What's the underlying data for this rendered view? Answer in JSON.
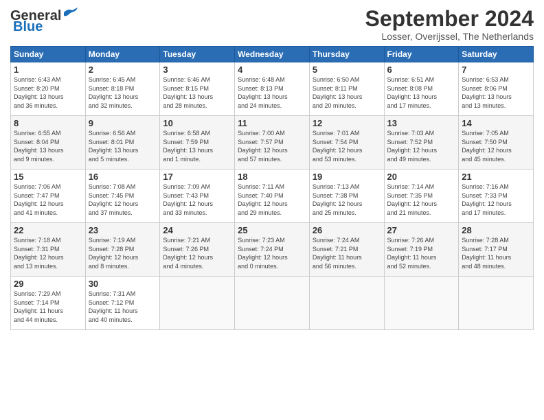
{
  "header": {
    "logo_line1": "General",
    "logo_line2": "Blue",
    "month_title": "September 2024",
    "location": "Losser, Overijssel, The Netherlands"
  },
  "days_of_week": [
    "Sunday",
    "Monday",
    "Tuesday",
    "Wednesday",
    "Thursday",
    "Friday",
    "Saturday"
  ],
  "weeks": [
    [
      {
        "day": "1",
        "info": "Sunrise: 6:43 AM\nSunset: 8:20 PM\nDaylight: 13 hours\nand 36 minutes."
      },
      {
        "day": "2",
        "info": "Sunrise: 6:45 AM\nSunset: 8:18 PM\nDaylight: 13 hours\nand 32 minutes."
      },
      {
        "day": "3",
        "info": "Sunrise: 6:46 AM\nSunset: 8:15 PM\nDaylight: 13 hours\nand 28 minutes."
      },
      {
        "day": "4",
        "info": "Sunrise: 6:48 AM\nSunset: 8:13 PM\nDaylight: 13 hours\nand 24 minutes."
      },
      {
        "day": "5",
        "info": "Sunrise: 6:50 AM\nSunset: 8:11 PM\nDaylight: 13 hours\nand 20 minutes."
      },
      {
        "day": "6",
        "info": "Sunrise: 6:51 AM\nSunset: 8:08 PM\nDaylight: 13 hours\nand 17 minutes."
      },
      {
        "day": "7",
        "info": "Sunrise: 6:53 AM\nSunset: 8:06 PM\nDaylight: 13 hours\nand 13 minutes."
      }
    ],
    [
      {
        "day": "8",
        "info": "Sunrise: 6:55 AM\nSunset: 8:04 PM\nDaylight: 13 hours\nand 9 minutes."
      },
      {
        "day": "9",
        "info": "Sunrise: 6:56 AM\nSunset: 8:01 PM\nDaylight: 13 hours\nand 5 minutes."
      },
      {
        "day": "10",
        "info": "Sunrise: 6:58 AM\nSunset: 7:59 PM\nDaylight: 13 hours\nand 1 minute."
      },
      {
        "day": "11",
        "info": "Sunrise: 7:00 AM\nSunset: 7:57 PM\nDaylight: 12 hours\nand 57 minutes."
      },
      {
        "day": "12",
        "info": "Sunrise: 7:01 AM\nSunset: 7:54 PM\nDaylight: 12 hours\nand 53 minutes."
      },
      {
        "day": "13",
        "info": "Sunrise: 7:03 AM\nSunset: 7:52 PM\nDaylight: 12 hours\nand 49 minutes."
      },
      {
        "day": "14",
        "info": "Sunrise: 7:05 AM\nSunset: 7:50 PM\nDaylight: 12 hours\nand 45 minutes."
      }
    ],
    [
      {
        "day": "15",
        "info": "Sunrise: 7:06 AM\nSunset: 7:47 PM\nDaylight: 12 hours\nand 41 minutes."
      },
      {
        "day": "16",
        "info": "Sunrise: 7:08 AM\nSunset: 7:45 PM\nDaylight: 12 hours\nand 37 minutes."
      },
      {
        "day": "17",
        "info": "Sunrise: 7:09 AM\nSunset: 7:43 PM\nDaylight: 12 hours\nand 33 minutes."
      },
      {
        "day": "18",
        "info": "Sunrise: 7:11 AM\nSunset: 7:40 PM\nDaylight: 12 hours\nand 29 minutes."
      },
      {
        "day": "19",
        "info": "Sunrise: 7:13 AM\nSunset: 7:38 PM\nDaylight: 12 hours\nand 25 minutes."
      },
      {
        "day": "20",
        "info": "Sunrise: 7:14 AM\nSunset: 7:35 PM\nDaylight: 12 hours\nand 21 minutes."
      },
      {
        "day": "21",
        "info": "Sunrise: 7:16 AM\nSunset: 7:33 PM\nDaylight: 12 hours\nand 17 minutes."
      }
    ],
    [
      {
        "day": "22",
        "info": "Sunrise: 7:18 AM\nSunset: 7:31 PM\nDaylight: 12 hours\nand 13 minutes."
      },
      {
        "day": "23",
        "info": "Sunrise: 7:19 AM\nSunset: 7:28 PM\nDaylight: 12 hours\nand 8 minutes."
      },
      {
        "day": "24",
        "info": "Sunrise: 7:21 AM\nSunset: 7:26 PM\nDaylight: 12 hours\nand 4 minutes."
      },
      {
        "day": "25",
        "info": "Sunrise: 7:23 AM\nSunset: 7:24 PM\nDaylight: 12 hours\nand 0 minutes."
      },
      {
        "day": "26",
        "info": "Sunrise: 7:24 AM\nSunset: 7:21 PM\nDaylight: 11 hours\nand 56 minutes."
      },
      {
        "day": "27",
        "info": "Sunrise: 7:26 AM\nSunset: 7:19 PM\nDaylight: 11 hours\nand 52 minutes."
      },
      {
        "day": "28",
        "info": "Sunrise: 7:28 AM\nSunset: 7:17 PM\nDaylight: 11 hours\nand 48 minutes."
      }
    ],
    [
      {
        "day": "29",
        "info": "Sunrise: 7:29 AM\nSunset: 7:14 PM\nDaylight: 11 hours\nand 44 minutes."
      },
      {
        "day": "30",
        "info": "Sunrise: 7:31 AM\nSunset: 7:12 PM\nDaylight: 11 hours\nand 40 minutes."
      },
      {
        "day": "",
        "info": ""
      },
      {
        "day": "",
        "info": ""
      },
      {
        "day": "",
        "info": ""
      },
      {
        "day": "",
        "info": ""
      },
      {
        "day": "",
        "info": ""
      }
    ]
  ]
}
